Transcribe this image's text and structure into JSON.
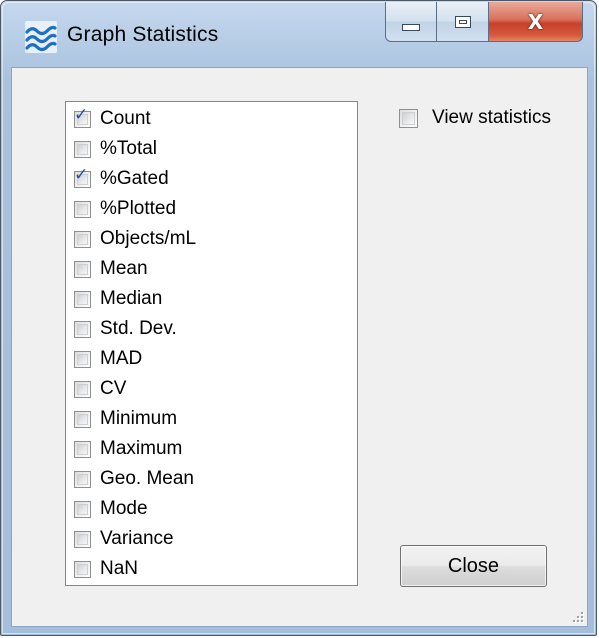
{
  "window": {
    "title": "Graph Statistics",
    "icon": "wave-icon"
  },
  "caption_buttons": {
    "minimize": "minimize-icon",
    "maximize": "maximize-icon",
    "close_glyph": "X"
  },
  "statistics": [
    {
      "label": "Count",
      "checked": true
    },
    {
      "label": "%Total",
      "checked": false
    },
    {
      "label": "%Gated",
      "checked": true
    },
    {
      "label": "%Plotted",
      "checked": false
    },
    {
      "label": "Objects/mL",
      "checked": false
    },
    {
      "label": "Mean",
      "checked": false
    },
    {
      "label": "Median",
      "checked": false
    },
    {
      "label": "Std. Dev.",
      "checked": false
    },
    {
      "label": "MAD",
      "checked": false
    },
    {
      "label": "CV",
      "checked": false
    },
    {
      "label": "Minimum",
      "checked": false
    },
    {
      "label": "Maximum",
      "checked": false
    },
    {
      "label": "Geo. Mean",
      "checked": false
    },
    {
      "label": "Mode",
      "checked": false
    },
    {
      "label": "Variance",
      "checked": false
    },
    {
      "label": "NaN",
      "checked": false
    }
  ],
  "view_statistics": {
    "label": "View statistics",
    "checked": false
  },
  "close_button": {
    "label": "Close"
  },
  "colors": {
    "check_mark": "#2b4fa3",
    "close_caption": "#c8402a",
    "client_bg": "#f0f0f0"
  }
}
